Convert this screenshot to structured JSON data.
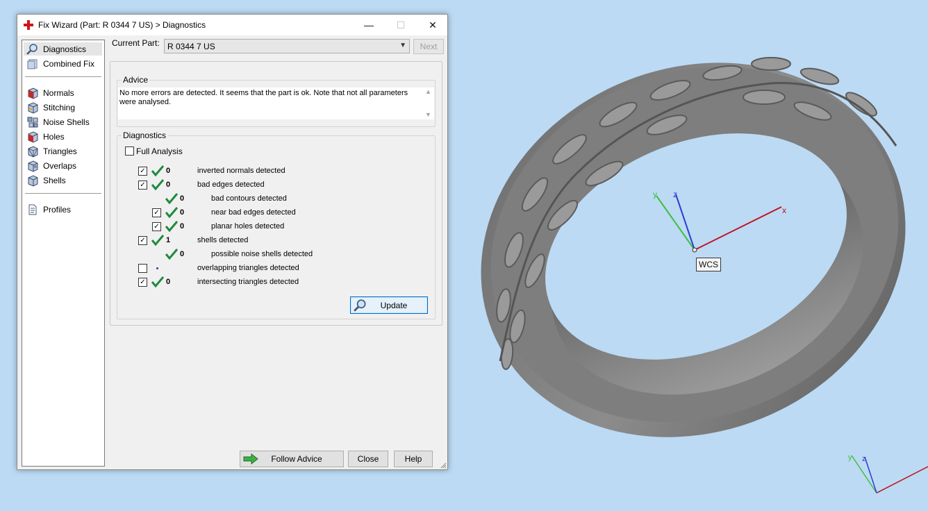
{
  "window": {
    "title": "Fix Wizard (Part: R 0344 7 US) > Diagnostics",
    "minimize_glyph": "—",
    "maximize_glyph": "☐",
    "close_glyph": "✕"
  },
  "sidebar": {
    "items": [
      {
        "label": "Diagnostics",
        "icon": "magnifier-icon"
      },
      {
        "label": "Combined Fix",
        "icon": "combined-fix-icon"
      },
      {
        "label": "Normals",
        "icon": "normals-cube-icon"
      },
      {
        "label": "Stitching",
        "icon": "stitching-cube-icon"
      },
      {
        "label": "Noise Shells",
        "icon": "noise-shells-icon"
      },
      {
        "label": "Holes",
        "icon": "holes-cube-icon"
      },
      {
        "label": "Triangles",
        "icon": "triangles-cube-icon"
      },
      {
        "label": "Overlaps",
        "icon": "overlaps-cube-icon"
      },
      {
        "label": "Shells",
        "icon": "shells-cube-icon"
      },
      {
        "label": "Profiles",
        "icon": "profiles-document-icon"
      }
    ]
  },
  "part": {
    "label": "Current Part:",
    "value": "R 0344 7 US",
    "next_label": "Next"
  },
  "advice": {
    "title": "Advice",
    "text": "No more errors are detected. It seems that the part is ok. Note that not all parameters were analysed."
  },
  "diagnostics": {
    "title": "Diagnostics",
    "full_analysis_label": "Full Analysis",
    "rows": [
      {
        "count": "0",
        "label": "inverted normals detected"
      },
      {
        "count": "0",
        "label": "bad edges detected"
      },
      {
        "count": "0",
        "label": "bad contours detected"
      },
      {
        "count": "0",
        "label": "near bad edges detected"
      },
      {
        "count": "0",
        "label": "planar holes detected"
      },
      {
        "count": "1",
        "label": "shells detected"
      },
      {
        "count": "0",
        "label": "possible noise shells detected"
      },
      {
        "count": "",
        "label": "overlapping triangles detected"
      },
      {
        "count": "0",
        "label": "intersecting triangles detected"
      }
    ],
    "update_label": "Update"
  },
  "footer": {
    "follow_advice_label": "Follow Advice",
    "close_label": "Close",
    "help_label": "Help"
  },
  "viewport": {
    "wcs_label": "WCS",
    "axis_x": "x",
    "axis_y": "y",
    "axis_z": "z",
    "background": "#bcdaf4"
  }
}
